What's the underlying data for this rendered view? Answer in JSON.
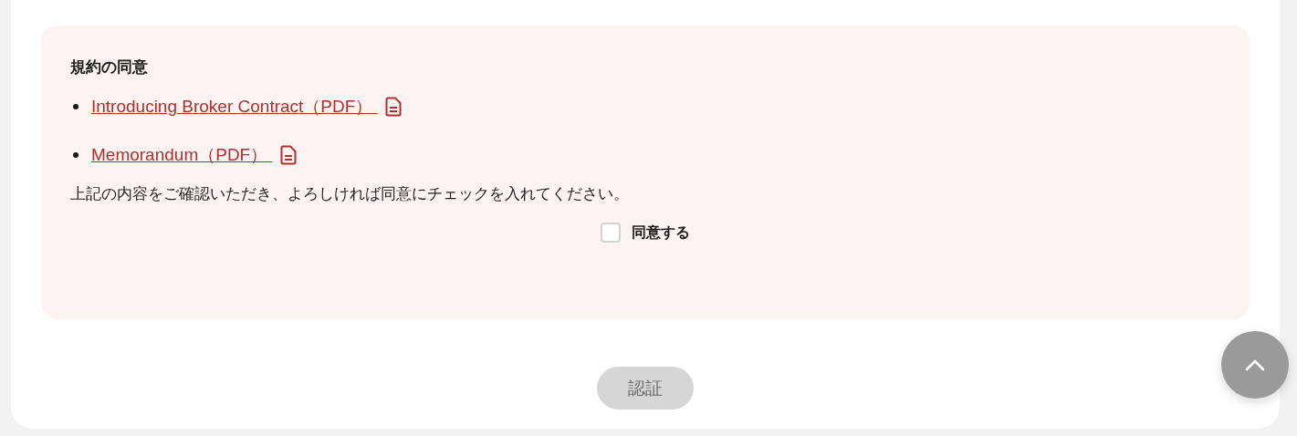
{
  "consent": {
    "title": "規約の同意",
    "documents": [
      {
        "label": "Introducing Broker Contract（PDF） "
      },
      {
        "label": "Memorandum（PDF） "
      }
    ],
    "instruction": "上記の内容をご確認いただき、よろしければ同意にチェックを入れてください。",
    "agree": {
      "label": "同意する",
      "checked": false
    }
  },
  "submit": {
    "label": "認証",
    "disabled": true
  }
}
